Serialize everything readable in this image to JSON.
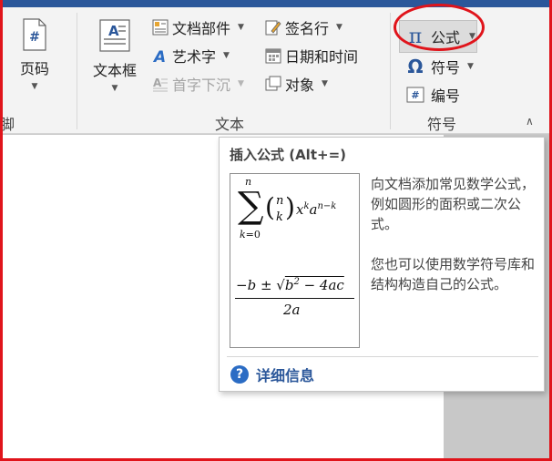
{
  "ribbon": {
    "partial_group_label": "脚",
    "text_group_label": "文本",
    "symbol_group_label": "符号",
    "page_number": "页码",
    "text_box": "文本框",
    "quick_parts": "文档部件",
    "wordart": "艺术字",
    "drop_cap": "首字下沉",
    "signature_line": "签名行",
    "date_time": "日期和时间",
    "object": "对象",
    "equation": "公式",
    "symbol": "符号",
    "number": "编号"
  },
  "tooltip": {
    "title": "插入公式 (Alt+=)",
    "desc1": "向文档添加常见数学公式，例如圆形的面积或二次公式。",
    "desc2": "您也可以使用数学符号库和结构构造自己的公式。",
    "more_info": "详细信息"
  },
  "colors": {
    "accent": "#2b579a",
    "annotation_red": "#e0141b"
  }
}
